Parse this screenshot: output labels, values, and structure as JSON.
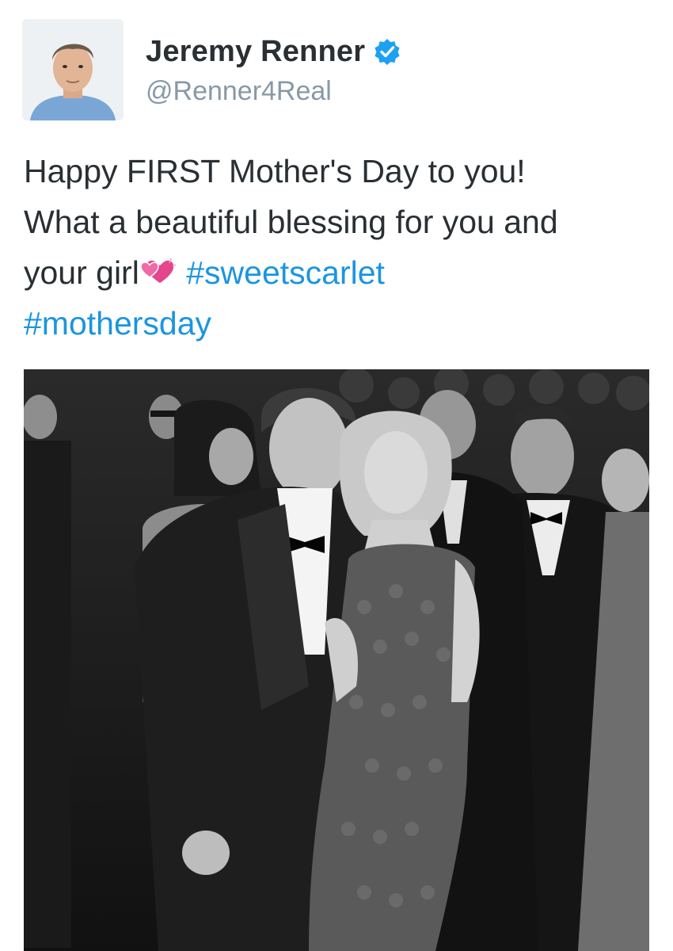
{
  "author": {
    "display_name": "Jeremy Renner",
    "handle": "@Renner4Real",
    "verified": true,
    "avatar_icon": "profile-photo-icon"
  },
  "tweet": {
    "line1": "Happy FIRST Mother's Day to you!",
    "line2": "What a beautiful blessing for you and",
    "line3_text": "your girl",
    "emoji_name": "two-hearts-emoji",
    "hashtag1": "#sweetscarlet",
    "hashtag2": "#mothersday"
  },
  "media": {
    "photo_icon": "red-carpet-photo-icon"
  },
  "colors": {
    "name": "#292f33",
    "handle": "#8899a6",
    "hashtag": "#1b95e0",
    "verified_badge": "#1da1f2",
    "emoji": "#e4458c"
  }
}
